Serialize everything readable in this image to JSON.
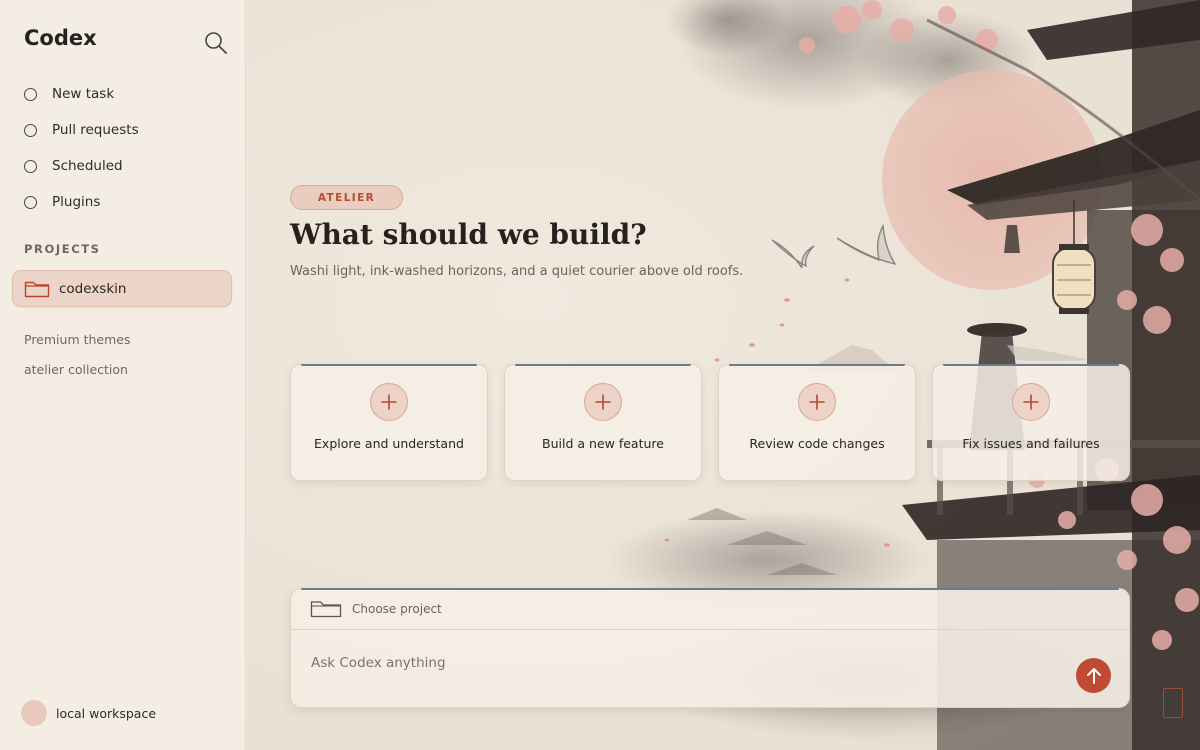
{
  "sidebar": {
    "app_title": "Codex",
    "nav": [
      {
        "label": "New task"
      },
      {
        "label": "Pull requests"
      },
      {
        "label": "Scheduled"
      },
      {
        "label": "Plugins"
      }
    ],
    "projects_title": "PROJECTS",
    "projects": [
      {
        "label": "codexskin",
        "active": true
      }
    ],
    "links": [
      {
        "label": "Premium themes"
      },
      {
        "label": "atelier collection"
      }
    ],
    "workspace_label": "local workspace"
  },
  "main": {
    "badge": "ATELIER",
    "headline": "What should we build?",
    "subline": "Washi light, ink-washed horizons, and a quiet courier above old roofs.",
    "cards": [
      {
        "label": "Explore and understand",
        "icon": "plus-icon"
      },
      {
        "label": "Build a new feature",
        "icon": "plus-icon"
      },
      {
        "label": "Review code changes",
        "icon": "plus-icon"
      },
      {
        "label": "Fix issues and failures",
        "icon": "plus-icon"
      }
    ],
    "composer": {
      "project_label": "Choose project",
      "placeholder": "Ask Codex anything"
    }
  },
  "colors": {
    "accent": "#c04a34",
    "badge_bg": "#ebcdc0",
    "active_project_bg": "#ecd5c8",
    "card_rule": "#6f7a83",
    "sun": "#e7b9ad",
    "blossom": "#e7aea7"
  }
}
